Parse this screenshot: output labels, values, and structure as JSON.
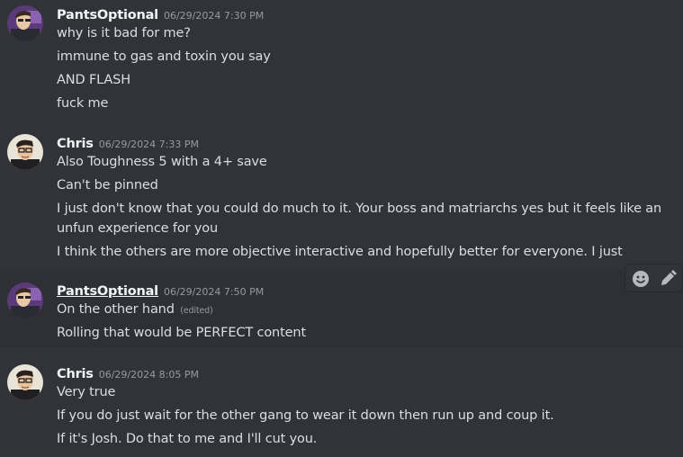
{
  "groups": [
    {
      "username": "PantsOptional",
      "timestamp": "06/29/2024 7:30 PM",
      "avatar": "pants-optional-avatar",
      "messages": [
        "why is it bad for me?",
        "immune to gas and toxin you say",
        "AND FLASH",
        "fuck me"
      ]
    },
    {
      "username": "Chris",
      "timestamp": "06/29/2024 7:33 PM",
      "avatar": "chris-avatar",
      "messages": [
        "Also Toughness 5 with a 4+ save",
        "Can't be pinned",
        "I just don't know that you could do much to it. Your boss and matriarchs yes but it feels like an unfun experience for you",
        "I think the others are more objective interactive and hopefully better for everyone. I just"
      ]
    },
    {
      "username": "PantsOptional",
      "timestamp": "06/29/2024 7:50 PM",
      "avatar": "pants-optional-avatar",
      "messages": [
        "On the other hand",
        "Rolling that would be PERFECT content"
      ],
      "edited_label": "(edited)"
    },
    {
      "username": "Chris",
      "timestamp": "06/29/2024 8:05 PM",
      "avatar": "chris-avatar",
      "messages": [
        "Very true",
        "If you do just wait for the other gang to wear it down then run up and coup it.",
        "If it's Josh. Do that to me and I'll cut you."
      ]
    }
  ],
  "toolbar": {
    "icons": [
      "emoji-icon",
      "pencil-icon"
    ]
  },
  "colors": {
    "background": "#313338",
    "hover_background": "#2e3035",
    "username": "#f2f3f5",
    "text": "#dbdee1",
    "muted": "#949ba4"
  }
}
